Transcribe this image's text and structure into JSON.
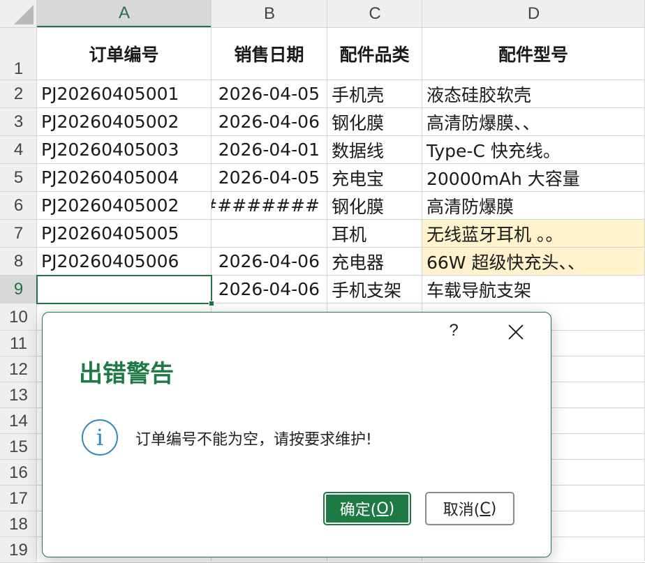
{
  "columns": [
    "A",
    "B",
    "C",
    "D"
  ],
  "row_numbers": [
    "1",
    "2",
    "3",
    "4",
    "5",
    "6",
    "7",
    "8",
    "9",
    "10",
    "11",
    "12",
    "13",
    "14",
    "15",
    "16",
    "17",
    "18",
    "19"
  ],
  "header_row": [
    "订单编号",
    "销售日期",
    "配件品类",
    "配件型号"
  ],
  "rows": [
    [
      "PJ20260405001",
      "2026-04-05",
      "手机壳",
      "液态硅胶软壳"
    ],
    [
      "PJ20260405002",
      "2026-04-06",
      "钢化膜",
      "高清防爆膜、、"
    ],
    [
      "PJ20260405003",
      "2026-04-01",
      "数据线",
      "Type-C 快充线。"
    ],
    [
      "PJ20260405004",
      "2026-04-05",
      "充电宝",
      "20000mAh 大容量"
    ],
    [
      "PJ20260405002",
      "#########",
      "钢化膜",
      "高清防爆膜"
    ],
    [
      "PJ20260405005",
      "",
      "耳机",
      "无线蓝牙耳机 。。"
    ],
    [
      "PJ20260405006",
      "2026-04-06",
      "充电器",
      "66W 超级快充头、、"
    ],
    [
      "",
      "2026-04-06",
      "手机支架",
      "车载导航支架"
    ]
  ],
  "highlighted_cells": [
    "D7",
    "D8"
  ],
  "selected_cell": "A9",
  "dialog": {
    "help_label": "?",
    "title": "出错警告",
    "info_glyph": "i",
    "message": "订单编号不能为空，请按要求维护!",
    "ok_text": "确定(",
    "ok_key": "O",
    "ok_tail": ")",
    "cancel_text": "取消(",
    "cancel_key": "C",
    "cancel_tail": ")"
  },
  "colors": {
    "accent": "#1e7a44",
    "highlight": "#fff2cc",
    "info": "#2e86c1"
  }
}
